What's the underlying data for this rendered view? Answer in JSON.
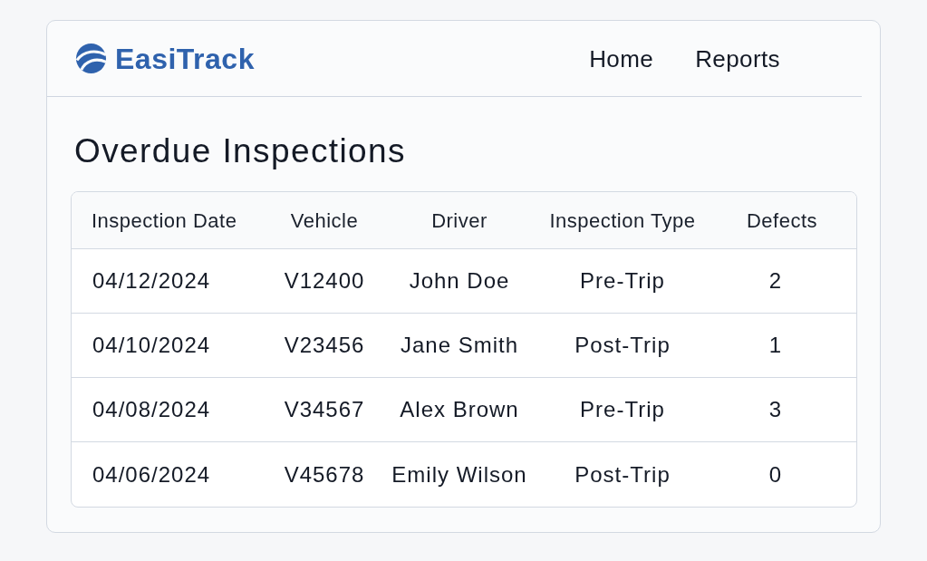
{
  "header": {
    "brand": "EasiTrack",
    "nav": [
      "Home",
      "Reports"
    ]
  },
  "page_title": "Overdue Inspections",
  "table": {
    "columns": [
      "Inspection Date",
      "Vehicle",
      "Driver",
      "Inspection Type",
      "Defects"
    ],
    "rows": [
      [
        "04/12/2024",
        "V12400",
        "John Doe",
        "Pre-Trip",
        "2"
      ],
      [
        "04/10/2024",
        "V23456",
        "Jane Smith",
        "Post-Trip",
        "1"
      ],
      [
        "04/08/2024",
        "V34567",
        "Alex Brown",
        "Pre-Trip",
        "3"
      ],
      [
        "04/06/2024",
        "V45678",
        "Emily Wilson",
        "Post-Trip",
        "0"
      ]
    ]
  }
}
